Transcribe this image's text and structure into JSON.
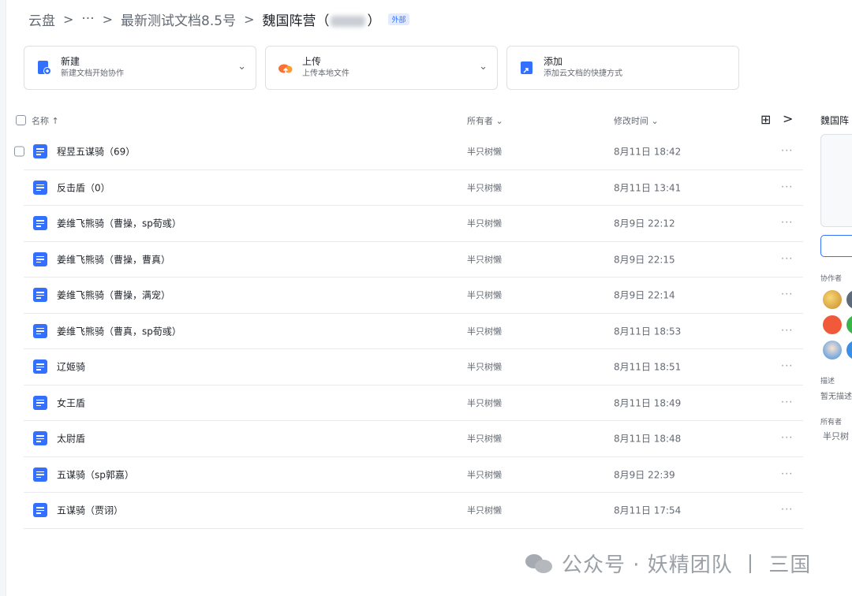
{
  "breadcrumb": {
    "root": "云盘",
    "sep": ">",
    "ellipsis": "···",
    "parent": "最新测试文档8.5号",
    "current": "魏国阵营（",
    "current_tail": "）",
    "badge": "外部"
  },
  "actions": [
    {
      "title": "新建",
      "subtitle": "新建文档开始协作",
      "icon": "new-doc-icon",
      "has_dropdown": true
    },
    {
      "title": "上传",
      "subtitle": "上传本地文件",
      "icon": "upload-cloud-icon",
      "has_dropdown": true
    },
    {
      "title": "添加",
      "subtitle": "添加云文档的快捷方式",
      "icon": "shortcut-icon",
      "has_dropdown": false
    }
  ],
  "table": {
    "headers": {
      "name": "名称",
      "name_sort": "↑",
      "owner": "所有者",
      "owner_sort": "⌄",
      "modified": "修改时间",
      "modified_sort": "⌄",
      "grid_icon": "⊞",
      "panel_toggle": ">"
    },
    "more": "···",
    "rows": [
      {
        "name": "程昱五谋骑（69）",
        "owner": "半只树懒",
        "time": "8月11日 18:42"
      },
      {
        "name": "反击盾（0）",
        "owner": "半只树懒",
        "time": "8月11日 13:41"
      },
      {
        "name": "姜维飞熊骑（曹操，sp荀彧）",
        "owner": "半只树懒",
        "time": "8月9日 22:12"
      },
      {
        "name": "姜维飞熊骑（曹操，曹真）",
        "owner": "半只树懒",
        "time": "8月9日 22:15"
      },
      {
        "name": "姜维飞熊骑（曹操，满宠）",
        "owner": "半只树懒",
        "time": "8月9日 22:14"
      },
      {
        "name": "姜维飞熊骑（曹真，sp荀彧）",
        "owner": "半只树懒",
        "time": "8月11日 18:53"
      },
      {
        "name": "辽姬骑",
        "owner": "半只树懒",
        "time": "8月11日 18:51"
      },
      {
        "name": "女王盾",
        "owner": "半只树懒",
        "time": "8月11日 18:49"
      },
      {
        "name": "太尉盾",
        "owner": "半只树懒",
        "time": "8月11日 18:48"
      },
      {
        "name": "五谋骑（sp郭嘉）",
        "owner": "半只树懒",
        "time": "8月9日 22:39"
      },
      {
        "name": "五谋骑（贾诩）",
        "owner": "半只树懒",
        "time": "8月11日 17:54"
      }
    ]
  },
  "panel": {
    "title": "魏国阵",
    "collaborators_label": "协作者",
    "description_label": "描述",
    "description_value": "暂无描述",
    "owner_label": "所有者",
    "owner_value": "半只树"
  },
  "watermark": "公众号 · 妖精团队 丨 三国",
  "colors": {
    "accent": "#3370ff",
    "upload": "#f77234",
    "text": "#1f2329",
    "muted": "#646a73"
  }
}
